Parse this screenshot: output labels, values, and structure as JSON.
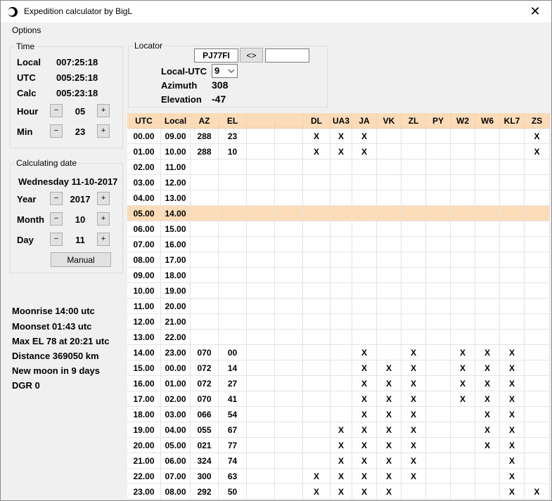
{
  "window": {
    "title": "Expedition calculator by BigL",
    "close_label": "✕"
  },
  "menu": {
    "options": "Options"
  },
  "time_group": {
    "legend": "Time",
    "local_label": "Local",
    "local_value": "007:25:18",
    "utc_label": "UTC",
    "utc_value": "005:25:18",
    "calc_label": "Calc",
    "calc_value": "005:23:18",
    "hour_label": "Hour",
    "hour_value": "05",
    "min_label": "Min",
    "min_value": "23",
    "minus": "−",
    "plus": "+"
  },
  "date_group": {
    "legend": "Calculating date",
    "date_text": "Wednesday 11-10-2017",
    "year_label": "Year",
    "year_value": "2017",
    "month_label": "Month",
    "month_value": "10",
    "day_label": "Day",
    "day_value": "11",
    "manual_button": "Manual"
  },
  "locator_group": {
    "legend": "Locator",
    "locator_value": "PJ77FI",
    "swap_button": "<>",
    "second_value": "",
    "local_utc_label": "Local-UTC",
    "local_utc_value": "9",
    "azimuth_label": "Azimuth",
    "azimuth_value": "308",
    "elevation_label": "Elevation",
    "elevation_value": "-47"
  },
  "moon_info": {
    "moonrise": "Moonrise 14:00 utc",
    "moonset": "Moonset 01:43 utc",
    "max_el": "Max EL 78 at 20:21 utc",
    "distance": "Distance 369050 km",
    "new_moon": "New moon in 9 days",
    "dgr": "DGR 0"
  },
  "grid": {
    "headers": [
      "UTC",
      "Local",
      "AZ",
      "EL",
      "",
      "",
      "DL",
      "UA3",
      "JA",
      "VK",
      "ZL",
      "PY",
      "W2",
      "W6",
      "KL7",
      "ZS"
    ],
    "highlight_row": 5,
    "rows": [
      [
        "00.00",
        "09.00",
        "288",
        "23",
        "",
        "",
        "X",
        "X",
        "X",
        "",
        "",
        "",
        "",
        "",
        "",
        "X"
      ],
      [
        "01.00",
        "10.00",
        "288",
        "10",
        "",
        "",
        "X",
        "X",
        "X",
        "",
        "",
        "",
        "",
        "",
        "",
        "X"
      ],
      [
        "02.00",
        "11.00",
        "",
        "",
        "",
        "",
        "",
        "",
        "",
        "",
        "",
        "",
        "",
        "",
        "",
        ""
      ],
      [
        "03.00",
        "12.00",
        "",
        "",
        "",
        "",
        "",
        "",
        "",
        "",
        "",
        "",
        "",
        "",
        "",
        ""
      ],
      [
        "04.00",
        "13.00",
        "",
        "",
        "",
        "",
        "",
        "",
        "",
        "",
        "",
        "",
        "",
        "",
        "",
        ""
      ],
      [
        "05.00",
        "14.00",
        "",
        "",
        "",
        "",
        "",
        "",
        "",
        "",
        "",
        "",
        "",
        "",
        "",
        ""
      ],
      [
        "06.00",
        "15.00",
        "",
        "",
        "",
        "",
        "",
        "",
        "",
        "",
        "",
        "",
        "",
        "",
        "",
        ""
      ],
      [
        "07.00",
        "16.00",
        "",
        "",
        "",
        "",
        "",
        "",
        "",
        "",
        "",
        "",
        "",
        "",
        "",
        ""
      ],
      [
        "08.00",
        "17.00",
        "",
        "",
        "",
        "",
        "",
        "",
        "",
        "",
        "",
        "",
        "",
        "",
        "",
        ""
      ],
      [
        "09.00",
        "18.00",
        "",
        "",
        "",
        "",
        "",
        "",
        "",
        "",
        "",
        "",
        "",
        "",
        "",
        ""
      ],
      [
        "10.00",
        "19.00",
        "",
        "",
        "",
        "",
        "",
        "",
        "",
        "",
        "",
        "",
        "",
        "",
        "",
        ""
      ],
      [
        "11.00",
        "20.00",
        "",
        "",
        "",
        "",
        "",
        "",
        "",
        "",
        "",
        "",
        "",
        "",
        "",
        ""
      ],
      [
        "12.00",
        "21.00",
        "",
        "",
        "",
        "",
        "",
        "",
        "",
        "",
        "",
        "",
        "",
        "",
        "",
        ""
      ],
      [
        "13.00",
        "22.00",
        "",
        "",
        "",
        "",
        "",
        "",
        "",
        "",
        "",
        "",
        "",
        "",
        "",
        ""
      ],
      [
        "14.00",
        "23.00",
        "070",
        "00",
        "",
        "",
        "",
        "",
        "X",
        "",
        "X",
        "",
        "X",
        "X",
        "X",
        ""
      ],
      [
        "15.00",
        "00.00",
        "072",
        "14",
        "",
        "",
        "",
        "",
        "X",
        "X",
        "X",
        "",
        "X",
        "X",
        "X",
        ""
      ],
      [
        "16.00",
        "01.00",
        "072",
        "27",
        "",
        "",
        "",
        "",
        "X",
        "X",
        "X",
        "",
        "X",
        "X",
        "X",
        ""
      ],
      [
        "17.00",
        "02.00",
        "070",
        "41",
        "",
        "",
        "",
        "",
        "X",
        "X",
        "X",
        "",
        "X",
        "X",
        "X",
        ""
      ],
      [
        "18.00",
        "03.00",
        "066",
        "54",
        "",
        "",
        "",
        "",
        "X",
        "X",
        "X",
        "",
        "",
        "X",
        "X",
        ""
      ],
      [
        "19.00",
        "04.00",
        "055",
        "67",
        "",
        "",
        "",
        "X",
        "X",
        "X",
        "X",
        "",
        "",
        "X",
        "X",
        ""
      ],
      [
        "20.00",
        "05.00",
        "021",
        "77",
        "",
        "",
        "",
        "X",
        "X",
        "X",
        "X",
        "",
        "",
        "X",
        "X",
        ""
      ],
      [
        "21.00",
        "06.00",
        "324",
        "74",
        "",
        "",
        "",
        "X",
        "X",
        "X",
        "X",
        "",
        "",
        "",
        "X",
        ""
      ],
      [
        "22.00",
        "07.00",
        "300",
        "63",
        "",
        "",
        "X",
        "X",
        "X",
        "X",
        "X",
        "",
        "",
        "",
        "X",
        ""
      ],
      [
        "23.00",
        "08.00",
        "292",
        "50",
        "",
        "",
        "X",
        "X",
        "X",
        "X",
        "",
        "",
        "",
        "",
        "X",
        "X"
      ]
    ]
  }
}
